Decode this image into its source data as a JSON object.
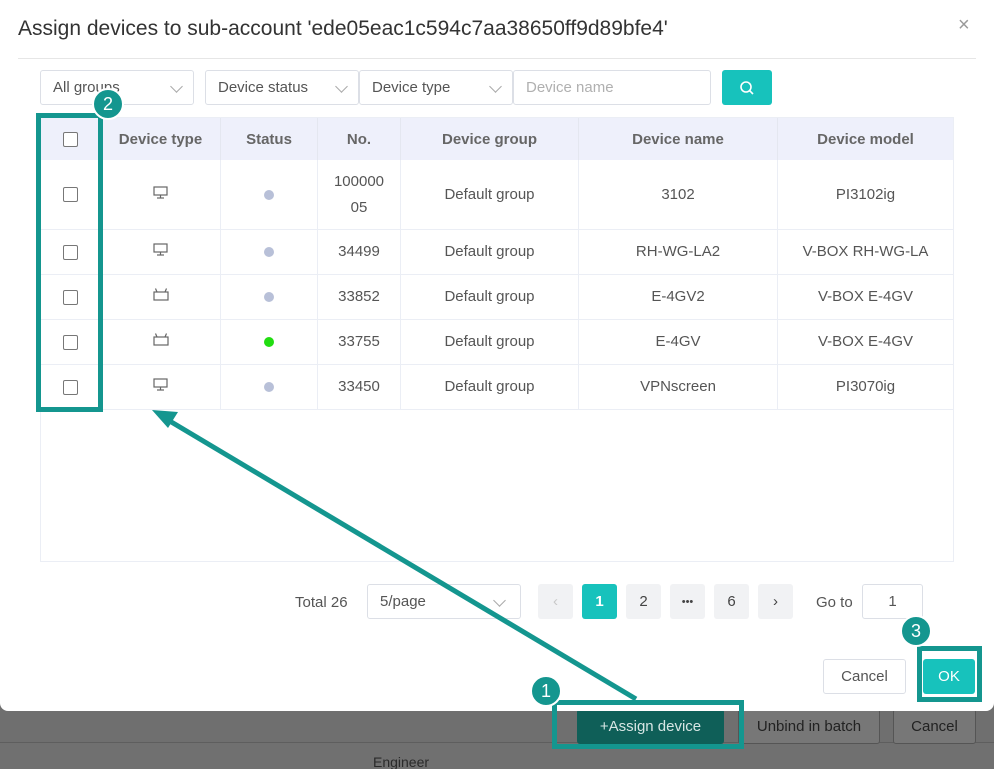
{
  "dialog": {
    "title": "Assign devices to sub-account 'ede05eac1c594c7aa38650ff9d89bfe4'",
    "close_icon": "×"
  },
  "filters": {
    "group": "All groups",
    "status": "Device status",
    "type": "Device type",
    "name_placeholder": "Device name",
    "search_icon": "search-icon"
  },
  "table": {
    "headers": [
      "Device type",
      "Status",
      "No.",
      "Device group",
      "Device name",
      "Device model"
    ],
    "rows": [
      {
        "type_icon": "monitor-icon",
        "status": "offline",
        "no": "100000 05",
        "group": "Default group",
        "name": "3102",
        "model": "PI3102ig"
      },
      {
        "type_icon": "monitor-icon",
        "status": "offline",
        "no": "34499",
        "group": "Default group",
        "name": "RH-WG-LA2",
        "model": "V-BOX RH-WG-LA"
      },
      {
        "type_icon": "router-icon",
        "status": "offline",
        "no": "33852",
        "group": "Default group",
        "name": "E-4GV2",
        "model": "V-BOX E-4GV"
      },
      {
        "type_icon": "router-icon",
        "status": "online",
        "no": "33755",
        "group": "Default group",
        "name": "E-4GV",
        "model": "V-BOX E-4GV"
      },
      {
        "type_icon": "monitor-icon",
        "status": "offline",
        "no": "33450",
        "group": "Default group",
        "name": "VPNscreen",
        "model": "PI3070ig"
      }
    ]
  },
  "pagination": {
    "total": "Total 26",
    "page_size": "5/page",
    "prev": "‹",
    "pages": [
      "1",
      "2",
      "•••",
      "6"
    ],
    "next": "›",
    "goto_label": "Go to",
    "goto_value": "1"
  },
  "footer": {
    "cancel": "Cancel",
    "ok": "OK"
  },
  "background": {
    "assign": "+Assign device",
    "unbind": "Unbind in batch",
    "cancel": "Cancel",
    "cell": "Engineer"
  },
  "annotations": {
    "badge1": "1",
    "badge2": "2",
    "badge3": "3"
  },
  "colors": {
    "accent": "#17c2bc",
    "annotation": "#14968f",
    "online": "#22dd11",
    "offline": "#b8c0d8"
  }
}
